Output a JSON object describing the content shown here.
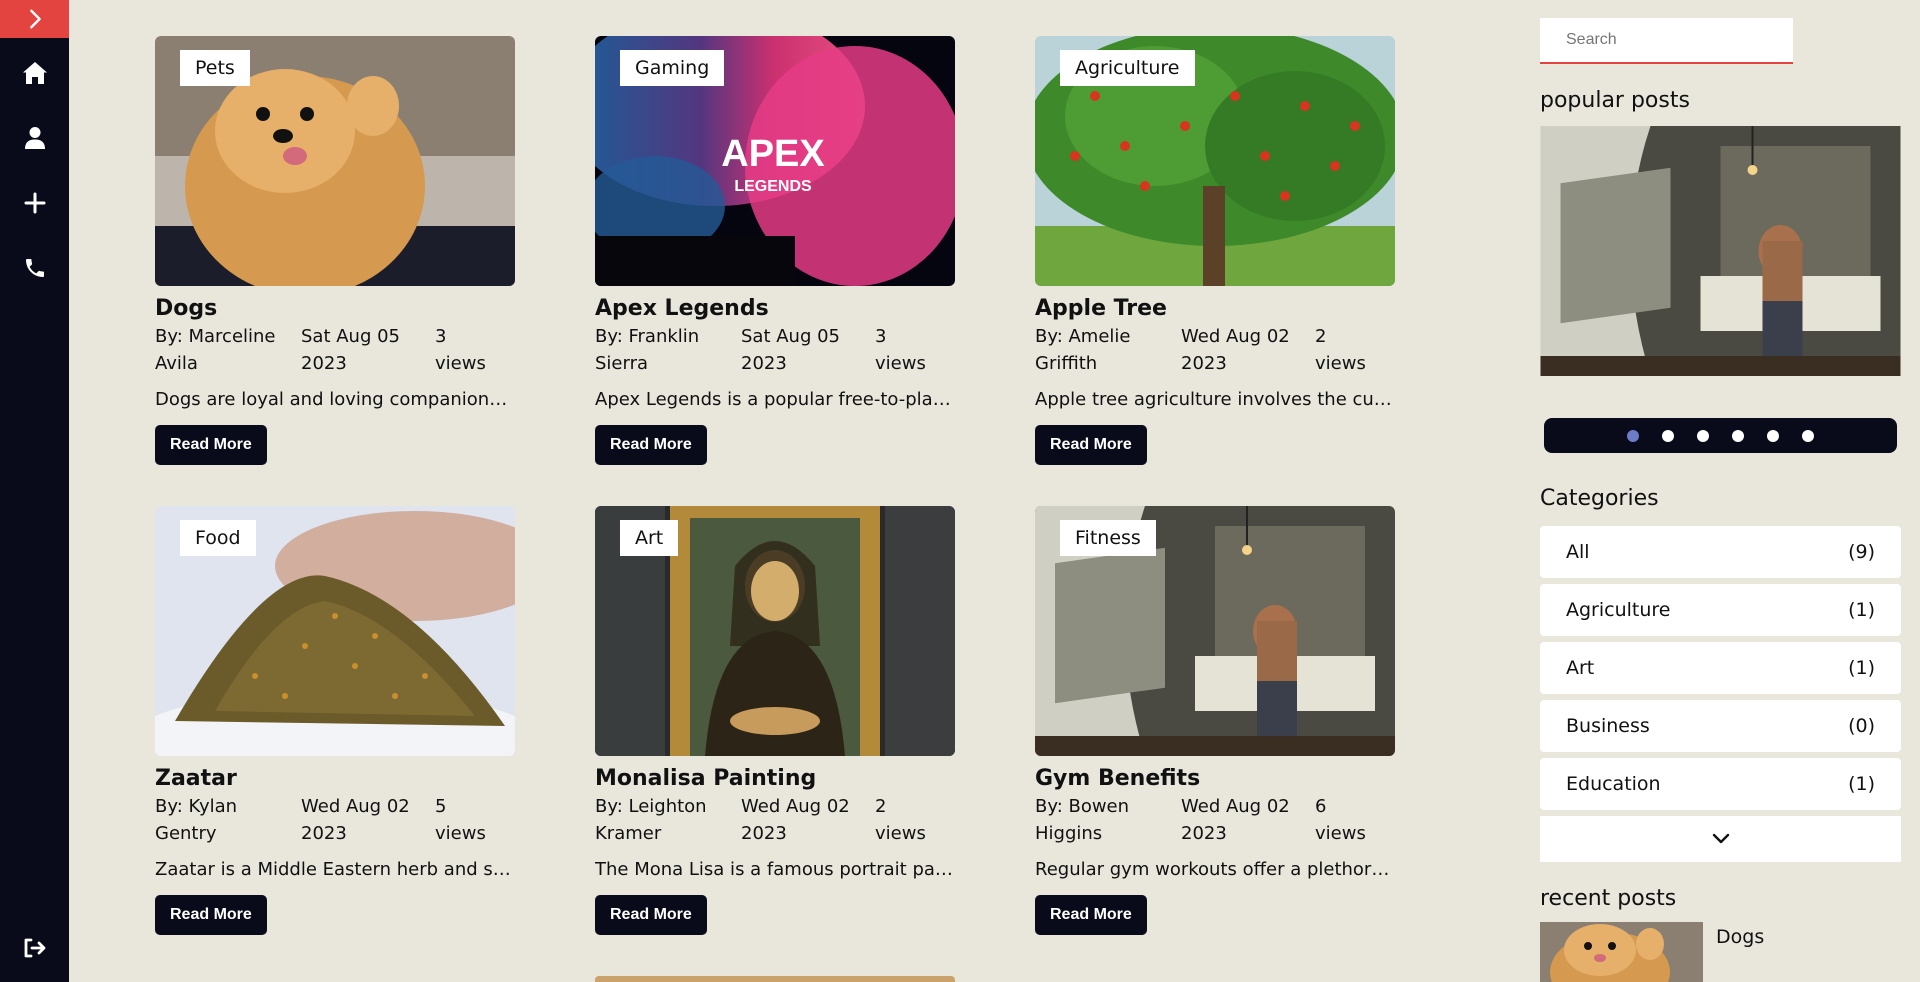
{
  "sidebar": {
    "items": [
      {
        "icon": "chevron-right-icon"
      },
      {
        "icon": "home-icon"
      },
      {
        "icon": "user-icon"
      },
      {
        "icon": "plus-icon"
      },
      {
        "icon": "phone-icon"
      },
      {
        "icon": "logout-icon"
      }
    ]
  },
  "posts": [
    {
      "category": "Pets",
      "title": "Dogs",
      "author": "By: Marceline Avila",
      "date": "Sat Aug 05 2023",
      "views": "3 views",
      "excerpt": "Dogs are loyal and loving companions,...",
      "read_more": "Read More"
    },
    {
      "category": "Gaming",
      "title": "Apex Legends",
      "author": "By: Franklin Sierra",
      "date": "Sat Aug 05 2023",
      "views": "3 views",
      "excerpt": "Apex Legends is a popular free-to-play...",
      "read_more": "Read More",
      "logo_line1": "APEX",
      "logo_line2": "LEGENDS"
    },
    {
      "category": "Agriculture",
      "title": "Apple Tree",
      "author": "By: Amelie Griffith",
      "date": "Wed Aug 02 2023",
      "views": "2 views",
      "excerpt": "Apple tree agriculture involves the culti...",
      "read_more": "Read More"
    },
    {
      "category": "Food",
      "title": "Zaatar",
      "author": "By: Kylan Gentry",
      "date": "Wed Aug 02 2023",
      "views": "5 views",
      "excerpt": "Zaatar is a Middle Eastern herb and spi...",
      "read_more": "Read More"
    },
    {
      "category": "Art",
      "title": "Monalisa Painting",
      "author": "By: Leighton Kramer",
      "date": "Wed Aug 02 2023",
      "views": "2 views",
      "excerpt": "The Mona Lisa is a famous portrait pai...",
      "read_more": "Read More"
    },
    {
      "category": "Fitness",
      "title": "Gym Benefits",
      "author": "By: Bowen Higgins",
      "date": "Wed Aug 02 2023",
      "views": "6 views",
      "excerpt": "Regular gym workouts offer a plethora...",
      "read_more": "Read More"
    }
  ],
  "search": {
    "placeholder": "Search"
  },
  "popular": {
    "title": "popular posts",
    "slides": 6,
    "active": 1
  },
  "categories": {
    "title": "Categories",
    "items": [
      {
        "name": "All",
        "count": "(9)"
      },
      {
        "name": "Agriculture",
        "count": "(1)"
      },
      {
        "name": "Art",
        "count": "(1)"
      },
      {
        "name": "Business",
        "count": "(0)"
      },
      {
        "name": "Education",
        "count": "(1)"
      }
    ],
    "more_icon": "chevron-down-icon"
  },
  "recent": {
    "title": "recent posts",
    "items": [
      {
        "title": "Dogs"
      }
    ]
  },
  "colors": {
    "accent": "#e3443f",
    "navy": "#090b1b",
    "background": "#e9e6dc",
    "dot_active": "#6d7bc7"
  }
}
